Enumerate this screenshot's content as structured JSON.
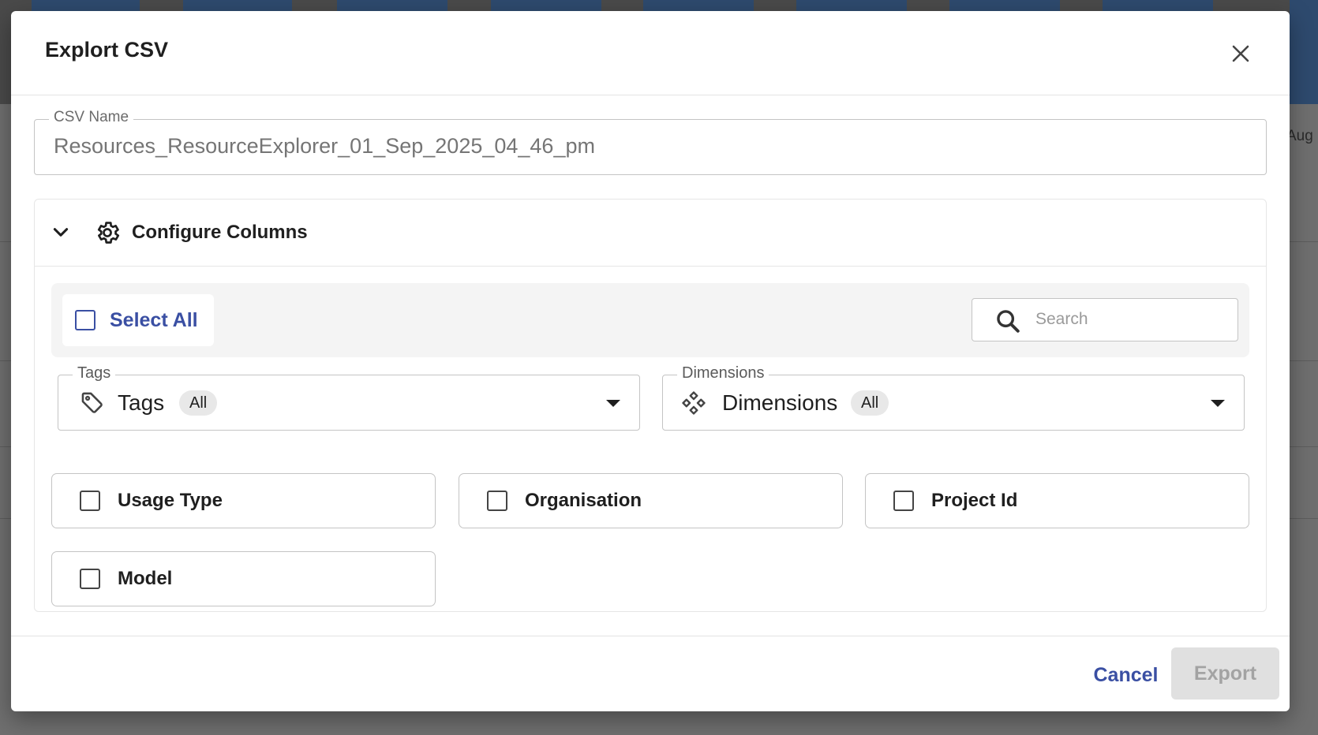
{
  "background": {
    "partial_label": "Aug"
  },
  "dialog": {
    "title": "Explort CSV",
    "close_icon": "close-icon"
  },
  "csv_name": {
    "label": "CSV Name",
    "placeholder": "Resources_ResourceExplorer_01_Sep_2025_04_46_pm"
  },
  "configure_columns": {
    "title": "Configure Columns",
    "expanded": true,
    "toggle_icon": "chevron-down-icon",
    "header_icon": "gear-icon",
    "select_all": {
      "label": "Select All",
      "checked": false
    },
    "search": {
      "placeholder": "Search",
      "value": ""
    },
    "tags": {
      "label": "Tags",
      "value": "Tags",
      "chip": "All",
      "icon": "tag-icon"
    },
    "dimensions": {
      "label": "Dimensions",
      "value": "Dimensions",
      "chip": "All",
      "icon": "dimensions-icon"
    },
    "columns": [
      {
        "label": "Usage Type",
        "checked": false
      },
      {
        "label": "Organisation",
        "checked": false
      },
      {
        "label": "Project Id",
        "checked": false
      },
      {
        "label": "Model",
        "checked": false
      }
    ]
  },
  "footer": {
    "cancel_label": "Cancel",
    "export_label": "Export",
    "export_disabled": true
  },
  "colors": {
    "accent": "#3a4fa3",
    "overlay": "#6f6f6f",
    "disabled_bg": "#e0e0e0",
    "disabled_text": "#a3a3a3"
  }
}
